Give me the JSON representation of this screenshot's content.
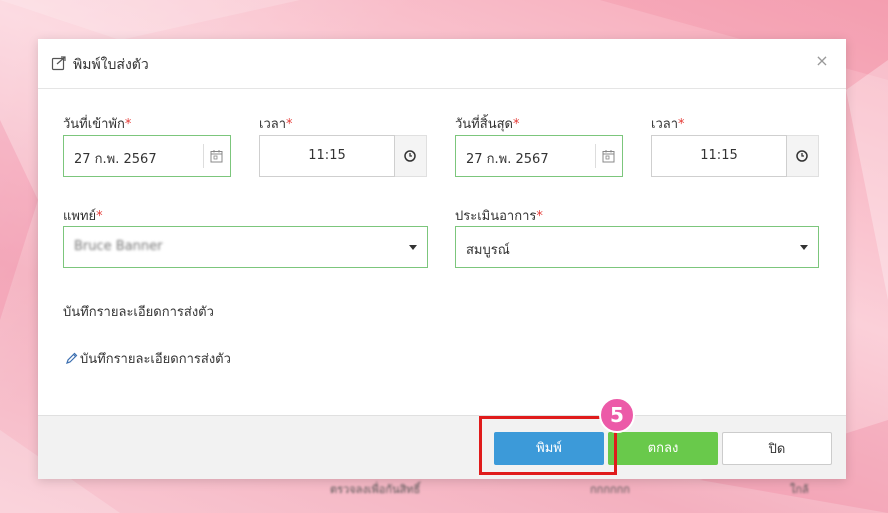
{
  "modal": {
    "title": "พิมพ์ใบส่งตัว",
    "close_glyph": "×",
    "title_icon": "share-icon"
  },
  "form": {
    "admit_date": {
      "label": "วันที่เข้าพัก",
      "required_mark": "*",
      "value": "27 ก.พ. 2567",
      "icon": "calendar-icon"
    },
    "admit_time": {
      "label": "เวลา",
      "required_mark": "*",
      "value": "11:15",
      "icon": "clock-icon"
    },
    "end_date": {
      "label": "วันที่สิ้นสุด",
      "required_mark": "*",
      "value": "27 ก.พ. 2567",
      "icon": "calendar-icon"
    },
    "end_time": {
      "label": "เวลา",
      "required_mark": "*",
      "value": "11:15",
      "icon": "clock-icon"
    },
    "doctor": {
      "label": "แพทย์",
      "required_mark": "*",
      "value": "Bruce Banner"
    },
    "assessment": {
      "label": "ประเมินอาการ",
      "required_mark": "*",
      "value": "สมบูรณ์"
    }
  },
  "notes": {
    "section_title": "บันทึกรายละเอียดการส่งตัว",
    "edit_link": "บันทึกรายละเอียดการส่งตัว",
    "edit_icon": "pencil-icon"
  },
  "footer": {
    "print_label": "พิมพ์",
    "ok_label": "ตกลง",
    "close_label": "ปิด"
  },
  "annotation": {
    "step_number": "5",
    "highlight_color": "#e01b1b",
    "badge_color": "#ec5aa8"
  },
  "colors": {
    "primary": "#3c9ad9",
    "success": "#69c94b",
    "required": "#e53935",
    "valid_border": "#7cc67c"
  }
}
